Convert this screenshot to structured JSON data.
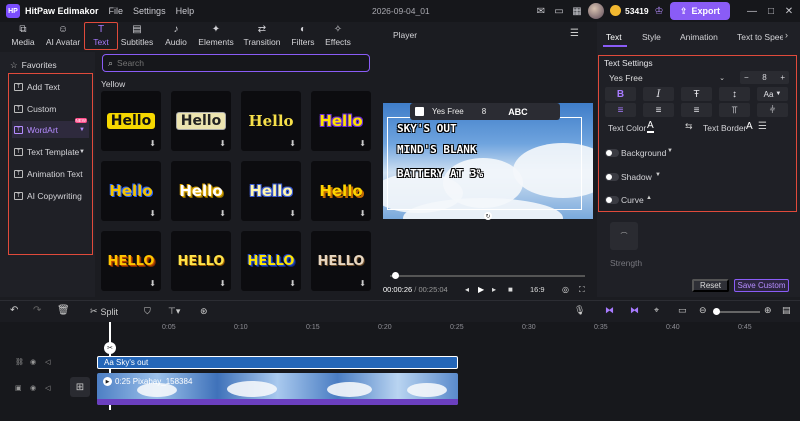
{
  "app": {
    "title": "HitPaw Edimakor",
    "menus": [
      "File",
      "Settings",
      "Help"
    ],
    "project": "2026-09-04_01",
    "coins": "53419",
    "export_label": "Export"
  },
  "toolbar": {
    "tools": [
      {
        "label": "Media",
        "icon": "media-icon"
      },
      {
        "label": "AI Avatar",
        "icon": "ai-avatar-icon"
      },
      {
        "label": "Text",
        "icon": "text-icon"
      },
      {
        "label": "Subtitles",
        "icon": "subtitles-icon"
      },
      {
        "label": "Audio",
        "icon": "audio-icon"
      },
      {
        "label": "Elements",
        "icon": "elements-icon"
      },
      {
        "label": "Transition",
        "icon": "transition-icon"
      },
      {
        "label": "Filters",
        "icon": "filters-icon"
      },
      {
        "label": "Effects",
        "icon": "effects-icon"
      }
    ]
  },
  "left_panel": {
    "favorites": "Favorites",
    "categories": [
      "Add Text",
      "Custom",
      "WordArt",
      "Text Template",
      "Animation Text",
      "AI Copywriting"
    ],
    "new_badge": "NEW"
  },
  "content": {
    "search_placeholder": "Search",
    "section_label": "Yellow",
    "tiles": [
      "Hello",
      "Hello",
      "Hello",
      "Hello",
      "Hello",
      "Hello",
      "Hello",
      "Hello",
      "HELLO",
      "HELLO",
      "HELLO",
      "HELLO"
    ]
  },
  "player": {
    "title": "Player",
    "floating_font": "Yes Free",
    "floating_size": "8",
    "floating_abc": "ABC",
    "lines": [
      "SKY'S OUT",
      "MIND'S BLANK",
      "BATTERY AT 3%"
    ],
    "current_time": "00:00:26",
    "total_time": "00:25:04",
    "aspect": "16:9"
  },
  "right_panel": {
    "tabs": [
      "Text",
      "Style",
      "Animation",
      "Text to Speech"
    ],
    "section_title": "Text Settings",
    "font": "Yes Free",
    "size": "8",
    "case_label": "Aa",
    "text_color_label": "Text Color",
    "text_border_label": "Text Border",
    "background_label": "Background",
    "shadow_label": "Shadow",
    "curve_label": "Curve",
    "strength_label": "Strength",
    "reset_label": "Reset",
    "save_custom_label": "Save Custom"
  },
  "timeline": {
    "split_label": "Split",
    "ticks": [
      "0:05",
      "0:10",
      "0:15",
      "0:20",
      "0:25",
      "0:30",
      "0:35",
      "0:40",
      "0:45"
    ],
    "text_clip": "Aa Sky's out",
    "video_clip": "0:25 Pixabay_158384"
  },
  "colors": {
    "accent": "#8a5cf6",
    "highlight_border": "#e04a3b",
    "text_clip": "#2466b8"
  }
}
